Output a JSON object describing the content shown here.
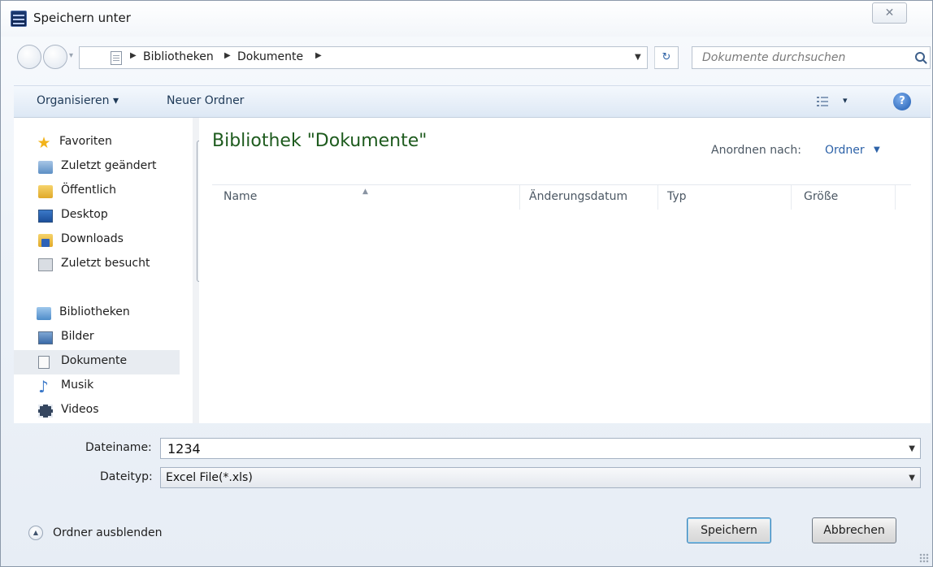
{
  "window": {
    "title": "Speichern unter",
    "close_label": "✕"
  },
  "address": {
    "breadcrumbs": [
      "Bibliotheken",
      "Dokumente"
    ],
    "search_placeholder": "Dokumente durchsuchen"
  },
  "toolbar": {
    "organize": "Organisieren ▾",
    "new_folder": "Neuer Ordner",
    "view_chevron": "▾",
    "help": "?"
  },
  "nav": {
    "items": [
      {
        "label": "Favoriten",
        "icon": "star-icon"
      },
      {
        "label": "Zuletzt geändert",
        "icon": "recent-changes-icon"
      },
      {
        "label": "Öffentlich",
        "icon": "folder-icon"
      },
      {
        "label": "Desktop",
        "icon": "desktop-icon"
      },
      {
        "label": "Downloads",
        "icon": "downloads-icon"
      },
      {
        "label": "Zuletzt besucht",
        "icon": "recent-places-icon"
      },
      {
        "label": "Bibliotheken",
        "icon": "libraries-icon"
      },
      {
        "label": "Bilder",
        "icon": "pictures-icon"
      },
      {
        "label": "Dokumente",
        "icon": "documents-icon",
        "selected": true
      },
      {
        "label": "Musik",
        "icon": "music-icon"
      },
      {
        "label": "Videos",
        "icon": "videos-icon"
      }
    ]
  },
  "content": {
    "title": "Bibliothek \"Dokumente\"",
    "arrange_label": "Anordnen nach:",
    "arrange_value": "Ordner",
    "columns": [
      "Name",
      "Änderungsdatum",
      "Typ",
      "Größe"
    ]
  },
  "form": {
    "filename_label": "Dateiname:",
    "filename_value": "1234",
    "filetype_label": "Dateityp:",
    "filetype_value": "Excel File(*.xls)"
  },
  "footer": {
    "hide_folders": "Ordner ausblenden",
    "save": "Speichern",
    "cancel": "Abbrechen"
  },
  "colors": {
    "accent_link": "#2d62a8",
    "library_title": "#1e5b1e",
    "toolbar_text": "#1e3957"
  }
}
